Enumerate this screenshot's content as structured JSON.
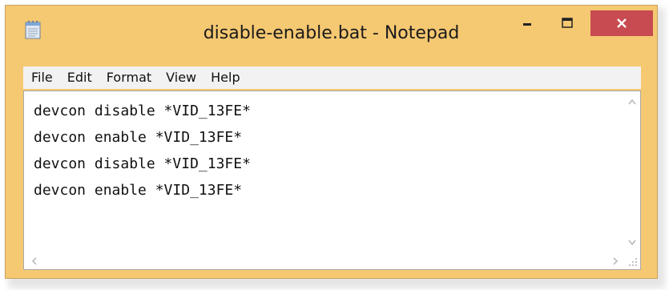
{
  "window": {
    "title": "disable-enable.bat - Notepad",
    "close_color": "#c74b50",
    "frame_color": "#f5c872"
  },
  "icons": {
    "app": "notepad-icon",
    "minimize": "minimize-icon",
    "maximize": "maximize-icon",
    "close": "close-icon",
    "scroll_up": "chevron-up-icon",
    "scroll_down": "chevron-down-icon",
    "scroll_left": "chevron-left-icon",
    "scroll_right": "chevron-right-icon",
    "resize_grip": "resize-grip-icon"
  },
  "menu": {
    "items": [
      {
        "label": "File"
      },
      {
        "label": "Edit"
      },
      {
        "label": "Format"
      },
      {
        "label": "View"
      },
      {
        "label": "Help"
      }
    ]
  },
  "editor": {
    "lines": [
      "devcon disable *VID_13FE*",
      "devcon enable *VID_13FE*",
      "devcon disable *VID_13FE*",
      "devcon enable *VID_13FE*"
    ]
  }
}
